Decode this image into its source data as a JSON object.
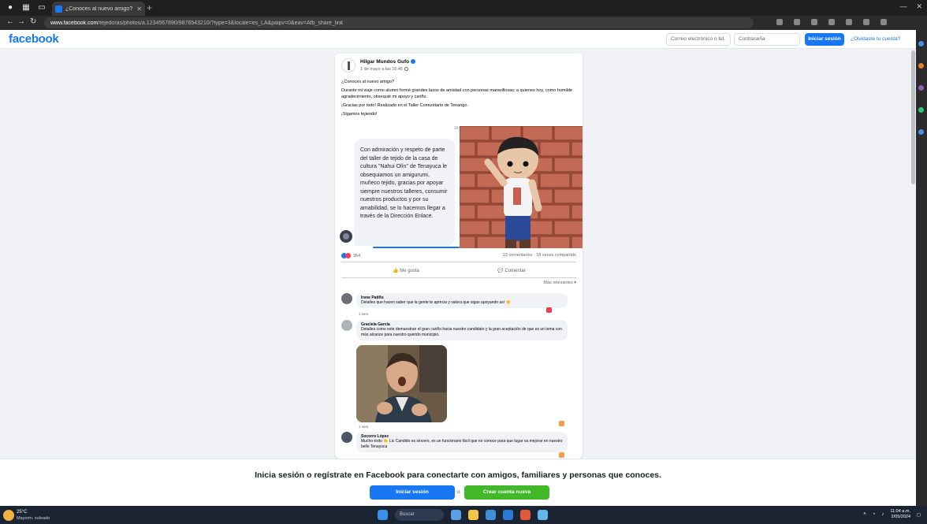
{
  "browser": {
    "tab_title": "¿Conoces al nuevo amigo? Dale ...",
    "url_domain": "www.facebook.com",
    "url_rest": "/tejedoras/photos/a.1234567890/9876543210/?type=3&locale=es_LA&paipv=0&eav=Afb_share_link"
  },
  "header": {
    "logo": "facebook",
    "email_placeholder": "Correo electrónico o tel.",
    "password_placeholder": "Contraseña",
    "login_label": "Iniciar sesión",
    "forgot_label": "¿Olvidaste tu cuenta?"
  },
  "post": {
    "page_name": "Hilgar Mundos Gufo",
    "time": "1 de mayo a las 16:45",
    "text": [
      "¿Conoces al nuevo amigo?",
      "Durante mi viaje como alumni formé grandes lazos de amistad con personas maravillosas; a quienes hoy, como humilde agradecimiento, obsequié mi apoyo y cariño.",
      "¡Gracias por todo! Realizado en el Taller Comunitario de Tenango.",
      "¡Sigamos tejiendo!"
    ],
    "shared_label": "16:03",
    "message_text": "Con admiración y respeto de parte del taller de tejido de la casa de cultura \"Nahui Olín\" de Tenayuca le obsequiamos un amigurumi, muñeco tejido, gracias por apoyar siempre nuestros talleres, consumir nuestros productos y por su amabilidad, se lo hacemos llegar a través de la Dirección Enlace.",
    "reaction_count": "354",
    "stats": "23 comentarios · 18 veces compartido",
    "like_label": "Me gusta",
    "comment_label": "Comentar",
    "sort_label": "Más relevantes ▾"
  },
  "comments": [
    {
      "name": "Irene Patiño",
      "text": "Detalles que hacen saber que la gente te aprecia y valora que sigas apoyando así 👏",
      "meta": "1 sem"
    },
    {
      "name": "Graciela García",
      "text": "Detalles como este demuestran el gran cariño hacia nuestro candidato y la gran aceptación de que es un tema con más alcance para nuestro querido municipio.",
      "meta": "1 sem"
    },
    {
      "name": "Socorro López",
      "text": "Mucho éxito 👏 Lic Candido es sincero, es un funcionario fácil que no conoce para que lugar va mejorar en nuestro bello Tenayuca",
      "meta": "1 sem"
    }
  ],
  "banner": {
    "title": "Inicia sesión o regístrate en Facebook para conectarte con amigos, familiares y personas que conoces.",
    "login_label": "Iniciar sesión",
    "or_label": "o",
    "create_label": "Crear cuenta nueva"
  },
  "taskbar": {
    "temp": "25°C",
    "weather": "Mayorm. soleado",
    "search_label": "Buscar",
    "time": "11:04 a.m.",
    "date": "2/05/2024"
  },
  "colors": {
    "facebook_blue": "#1877f2",
    "create_green": "#42b72a"
  }
}
